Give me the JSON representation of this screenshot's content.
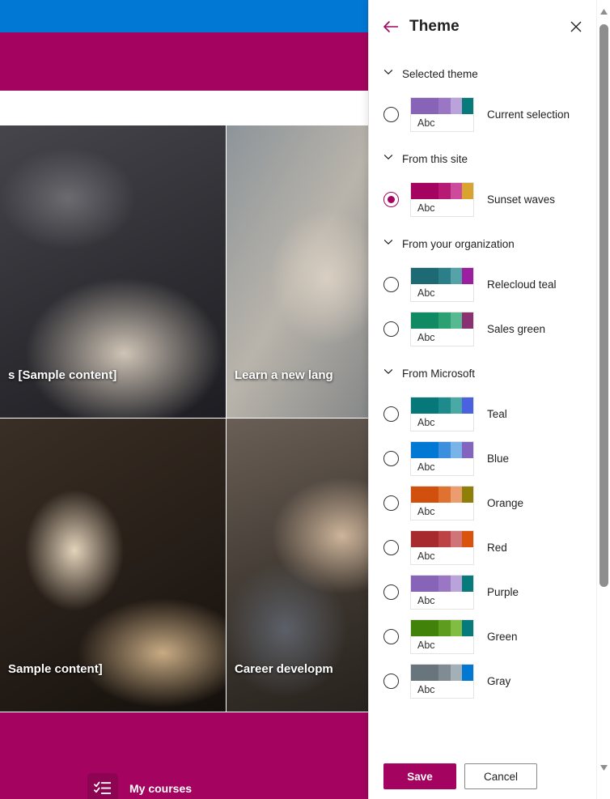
{
  "background": {
    "topbar_color": "#0078d4",
    "band_color": "#a4045f",
    "cards": [
      {
        "title": "s [Sample content]",
        "photo": "handshake-photo",
        "align": "left"
      },
      {
        "title": "Learn a new lang",
        "photo": "office-photo",
        "align": "right"
      },
      {
        "title": "Sample content]",
        "photo": "desk-photo",
        "align": "left"
      },
      {
        "title": "Career developm",
        "photo": "hands-photo",
        "align": "right"
      }
    ],
    "bottom_nav": {
      "icon": "checklist-icon",
      "label": "My courses"
    }
  },
  "panel": {
    "title": "Theme",
    "back_icon": "back-arrow-icon",
    "close_icon": "close-icon",
    "chevron_icon": "chevron-down-icon",
    "sections": [
      {
        "label": "Selected theme",
        "themes": [
          {
            "name": "Current selection",
            "selected": false,
            "sample_text": "Abc",
            "colors": [
              "#8764b8",
              "#9a76c4",
              "#b9a3da",
              "#077b7b"
            ]
          }
        ]
      },
      {
        "label": "From this site",
        "themes": [
          {
            "name": "Sunset waves",
            "selected": true,
            "sample_text": "Abc",
            "colors": [
              "#a4045f",
              "#b61a74",
              "#cc4b9b",
              "#d9a32f"
            ]
          }
        ]
      },
      {
        "label": "From your organization",
        "themes": [
          {
            "name": "Relecloud teal",
            "selected": false,
            "sample_text": "Abc",
            "colors": [
              "#1d6a74",
              "#2b7f88",
              "#55a3a8",
              "#9b1fa0"
            ]
          },
          {
            "name": "Sales green",
            "selected": false,
            "sample_text": "Abc",
            "colors": [
              "#0f8a63",
              "#2ba173",
              "#56b992",
              "#8a3172"
            ]
          }
        ]
      },
      {
        "label": "From Microsoft",
        "themes": [
          {
            "name": "Teal",
            "selected": false,
            "sample_text": "Abc",
            "colors": [
              "#06787a",
              "#1d8b8c",
              "#4aa8a5",
              "#4a62e0"
            ]
          },
          {
            "name": "Blue",
            "selected": false,
            "sample_text": "Abc",
            "colors": [
              "#0078d4",
              "#3b8fdd",
              "#79b4e8",
              "#8364bf"
            ]
          },
          {
            "name": "Orange",
            "selected": false,
            "sample_text": "Abc",
            "colors": [
              "#d2500d",
              "#df7231",
              "#eb9d70",
              "#8d7f07"
            ]
          },
          {
            "name": "Red",
            "selected": false,
            "sample_text": "Abc",
            "colors": [
              "#a72b2e",
              "#bc4244",
              "#cf7578",
              "#da530c"
            ]
          },
          {
            "name": "Purple",
            "selected": false,
            "sample_text": "Abc",
            "colors": [
              "#8764b8",
              "#9a76c4",
              "#b9a3da",
              "#077b7b"
            ]
          },
          {
            "name": "Green",
            "selected": false,
            "sample_text": "Abc",
            "colors": [
              "#41820b",
              "#5d9c1e",
              "#81bc43",
              "#077b7b"
            ]
          },
          {
            "name": "Gray",
            "selected": false,
            "sample_text": "Abc",
            "colors": [
              "#69757c",
              "#808b92",
              "#a4b0b8",
              "#0078d4"
            ]
          }
        ]
      }
    ],
    "footer": {
      "save_label": "Save",
      "cancel_label": "Cancel",
      "save_color": "#a4045f"
    },
    "scrollbar": {
      "up_icon": "scroll-up-arrow-icon",
      "down_icon": "scroll-down-arrow-icon"
    }
  }
}
